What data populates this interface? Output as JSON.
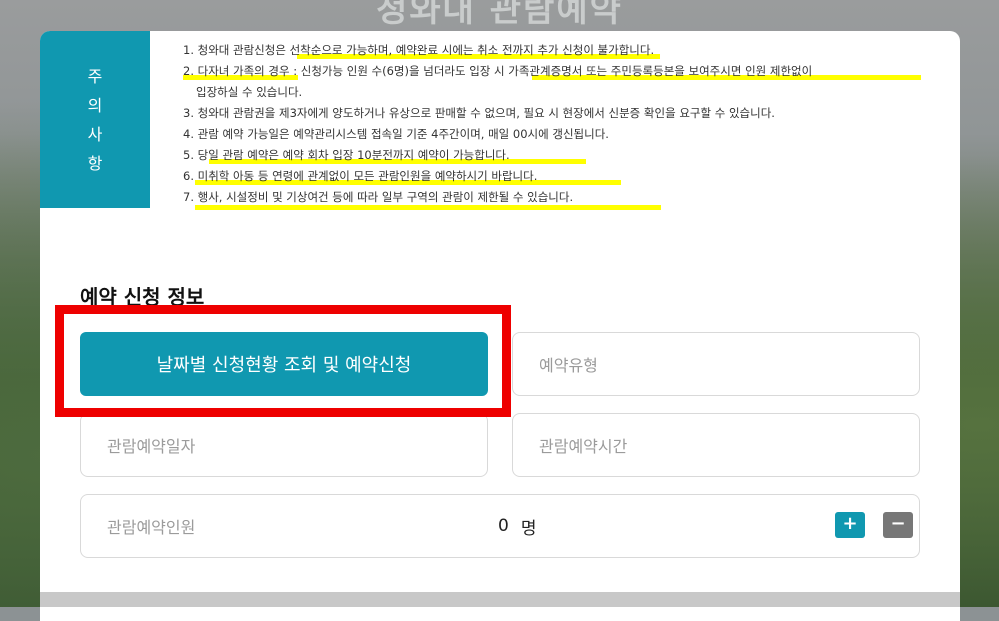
{
  "page": {
    "title": "청와대 관람예약"
  },
  "notice": {
    "tab_label": [
      "주",
      "의",
      "사",
      "항"
    ],
    "items": [
      "1. 청와대 관람신청은 선착순으로 가능하며, 예약완료 시에는 취소 전까지 추가 신청이 불가합니다.",
      "2. 다자녀 가족의 경우 : 신청가능 인원 수(6명)을 넘더라도 입장 시 가족관계증명서 또는 주민등록등본을 보여주시면 인원 제한없이",
      "입장하실 수 있습니다.",
      "3. 청와대 관람권을 제3자에게 양도하거나 유상으로 판매할 수 없으며, 필요 시 현장에서 신분증 확인을 요구할 수 있습니다.",
      "4. 관람 예약 가능일은 예약관리시스템 접속일 기준 4주간이며, 매일 00시에 갱신됩니다.",
      "5. 당일 관람 예약은 예약 회차 입장 10분전까지 예약이 가능합니다.",
      "6. 미취학 아동 등 연령에 관계없이 모든 관람인원을 예약하시기 바랍니다.",
      "7. 행사, 시설정비 및 기상여건 등에 따라 일부 구역의 관람이 제한될 수 있습니다."
    ],
    "highlight_color": "#ffff00"
  },
  "form": {
    "section_title": "예약 신청 정보",
    "primary_button": "날짜별 신청현황 조회 및 예약신청",
    "reservation_type_placeholder": "예약유형",
    "visit_date_placeholder": "관람예약일자",
    "visit_time_placeholder": "관람예약시간",
    "visitors_label": "관람예약인원",
    "visitors_count": "0",
    "visitors_unit": "명",
    "plus_label": "+",
    "minus_label": "−"
  },
  "colors": {
    "accent": "#1098b0",
    "annotation_box": "#ee0000",
    "minus_button": "#777777"
  }
}
